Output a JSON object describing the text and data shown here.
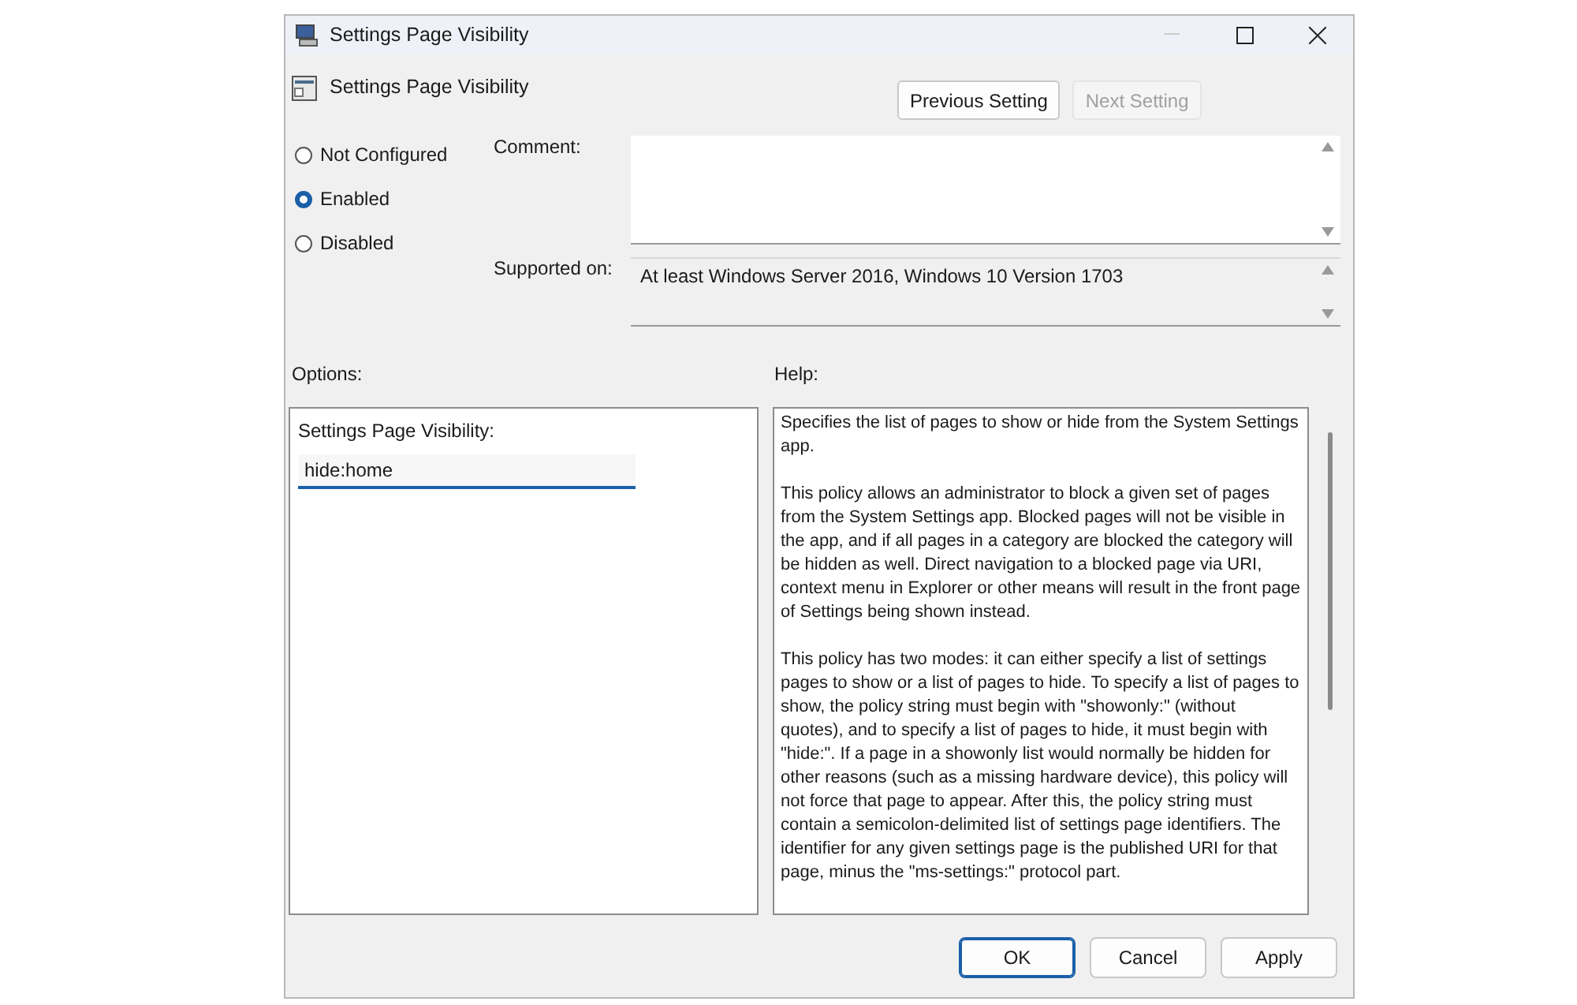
{
  "window": {
    "title": "Settings Page Visibility"
  },
  "policy_title": "Settings Page Visibility",
  "nav_buttons": [
    {
      "label": "Previous Setting",
      "disabled": false
    },
    {
      "label": "Next Setting",
      "disabled": true
    }
  ],
  "state_options": [
    {
      "label": "Not Configured",
      "selected": false
    },
    {
      "label": "Enabled",
      "selected": true
    },
    {
      "label": "Disabled",
      "selected": false
    }
  ],
  "comment": {
    "label": "Comment:"
  },
  "supported_on": {
    "label": "Supported on:",
    "value": "At least Windows Server 2016, Windows 10 Version 1703"
  },
  "options": {
    "heading": "Options:",
    "field_label": "Settings Page Visibility:",
    "value": "hide:home"
  },
  "help": {
    "heading": "Help:",
    "paragraphs": [
      "Specifies the list of pages to show or hide from the System Settings app.",
      "This policy allows an administrator to block a given set of pages from the System Settings app. Blocked pages will not be visible in the app, and if all pages in a category are blocked the category will be hidden as well. Direct navigation to a blocked page via URI, context menu in Explorer or other means will result in the front page of Settings being shown instead.",
      "This policy has two modes: it can either specify a list of settings pages to show or a list of pages to hide. To specify a list of pages to show, the policy string must begin with \"showonly:\" (without quotes), and to specify a list of pages to hide, it must begin with \"hide:\". If a page in a showonly list would normally be hidden for other reasons (such as a missing hardware device), this policy will not force that page to appear. After this, the policy string must contain a semicolon-delimited list of settings page identifiers. The identifier for any given settings page is the published URI for that page, minus the \"ms-settings:\" protocol part."
    ]
  },
  "buttons": [
    {
      "label": "OK",
      "default": true
    },
    {
      "label": "Cancel",
      "default": false
    },
    {
      "label": "Apply",
      "default": false
    }
  ]
}
